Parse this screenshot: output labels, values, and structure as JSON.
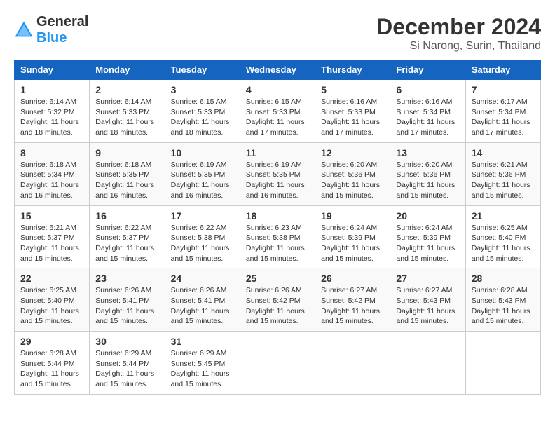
{
  "logo": {
    "text_general": "General",
    "text_blue": "Blue"
  },
  "title": {
    "month_year": "December 2024",
    "location": "Si Narong, Surin, Thailand"
  },
  "weekdays": [
    "Sunday",
    "Monday",
    "Tuesday",
    "Wednesday",
    "Thursday",
    "Friday",
    "Saturday"
  ],
  "weeks": [
    [
      {
        "day": "1",
        "sunrise": "Sunrise: 6:14 AM",
        "sunset": "Sunset: 5:32 PM",
        "daylight": "Daylight: 11 hours and 18 minutes."
      },
      {
        "day": "2",
        "sunrise": "Sunrise: 6:14 AM",
        "sunset": "Sunset: 5:33 PM",
        "daylight": "Daylight: 11 hours and 18 minutes."
      },
      {
        "day": "3",
        "sunrise": "Sunrise: 6:15 AM",
        "sunset": "Sunset: 5:33 PM",
        "daylight": "Daylight: 11 hours and 18 minutes."
      },
      {
        "day": "4",
        "sunrise": "Sunrise: 6:15 AM",
        "sunset": "Sunset: 5:33 PM",
        "daylight": "Daylight: 11 hours and 17 minutes."
      },
      {
        "day": "5",
        "sunrise": "Sunrise: 6:16 AM",
        "sunset": "Sunset: 5:33 PM",
        "daylight": "Daylight: 11 hours and 17 minutes."
      },
      {
        "day": "6",
        "sunrise": "Sunrise: 6:16 AM",
        "sunset": "Sunset: 5:34 PM",
        "daylight": "Daylight: 11 hours and 17 minutes."
      },
      {
        "day": "7",
        "sunrise": "Sunrise: 6:17 AM",
        "sunset": "Sunset: 5:34 PM",
        "daylight": "Daylight: 11 hours and 17 minutes."
      }
    ],
    [
      {
        "day": "8",
        "sunrise": "Sunrise: 6:18 AM",
        "sunset": "Sunset: 5:34 PM",
        "daylight": "Daylight: 11 hours and 16 minutes."
      },
      {
        "day": "9",
        "sunrise": "Sunrise: 6:18 AM",
        "sunset": "Sunset: 5:35 PM",
        "daylight": "Daylight: 11 hours and 16 minutes."
      },
      {
        "day": "10",
        "sunrise": "Sunrise: 6:19 AM",
        "sunset": "Sunset: 5:35 PM",
        "daylight": "Daylight: 11 hours and 16 minutes."
      },
      {
        "day": "11",
        "sunrise": "Sunrise: 6:19 AM",
        "sunset": "Sunset: 5:35 PM",
        "daylight": "Daylight: 11 hours and 16 minutes."
      },
      {
        "day": "12",
        "sunrise": "Sunrise: 6:20 AM",
        "sunset": "Sunset: 5:36 PM",
        "daylight": "Daylight: 11 hours and 15 minutes."
      },
      {
        "day": "13",
        "sunrise": "Sunrise: 6:20 AM",
        "sunset": "Sunset: 5:36 PM",
        "daylight": "Daylight: 11 hours and 15 minutes."
      },
      {
        "day": "14",
        "sunrise": "Sunrise: 6:21 AM",
        "sunset": "Sunset: 5:36 PM",
        "daylight": "Daylight: 11 hours and 15 minutes."
      }
    ],
    [
      {
        "day": "15",
        "sunrise": "Sunrise: 6:21 AM",
        "sunset": "Sunset: 5:37 PM",
        "daylight": "Daylight: 11 hours and 15 minutes."
      },
      {
        "day": "16",
        "sunrise": "Sunrise: 6:22 AM",
        "sunset": "Sunset: 5:37 PM",
        "daylight": "Daylight: 11 hours and 15 minutes."
      },
      {
        "day": "17",
        "sunrise": "Sunrise: 6:22 AM",
        "sunset": "Sunset: 5:38 PM",
        "daylight": "Daylight: 11 hours and 15 minutes."
      },
      {
        "day": "18",
        "sunrise": "Sunrise: 6:23 AM",
        "sunset": "Sunset: 5:38 PM",
        "daylight": "Daylight: 11 hours and 15 minutes."
      },
      {
        "day": "19",
        "sunrise": "Sunrise: 6:24 AM",
        "sunset": "Sunset: 5:39 PM",
        "daylight": "Daylight: 11 hours and 15 minutes."
      },
      {
        "day": "20",
        "sunrise": "Sunrise: 6:24 AM",
        "sunset": "Sunset: 5:39 PM",
        "daylight": "Daylight: 11 hours and 15 minutes."
      },
      {
        "day": "21",
        "sunrise": "Sunrise: 6:25 AM",
        "sunset": "Sunset: 5:40 PM",
        "daylight": "Daylight: 11 hours and 15 minutes."
      }
    ],
    [
      {
        "day": "22",
        "sunrise": "Sunrise: 6:25 AM",
        "sunset": "Sunset: 5:40 PM",
        "daylight": "Daylight: 11 hours and 15 minutes."
      },
      {
        "day": "23",
        "sunrise": "Sunrise: 6:26 AM",
        "sunset": "Sunset: 5:41 PM",
        "daylight": "Daylight: 11 hours and 15 minutes."
      },
      {
        "day": "24",
        "sunrise": "Sunrise: 6:26 AM",
        "sunset": "Sunset: 5:41 PM",
        "daylight": "Daylight: 11 hours and 15 minutes."
      },
      {
        "day": "25",
        "sunrise": "Sunrise: 6:26 AM",
        "sunset": "Sunset: 5:42 PM",
        "daylight": "Daylight: 11 hours and 15 minutes."
      },
      {
        "day": "26",
        "sunrise": "Sunrise: 6:27 AM",
        "sunset": "Sunset: 5:42 PM",
        "daylight": "Daylight: 11 hours and 15 minutes."
      },
      {
        "day": "27",
        "sunrise": "Sunrise: 6:27 AM",
        "sunset": "Sunset: 5:43 PM",
        "daylight": "Daylight: 11 hours and 15 minutes."
      },
      {
        "day": "28",
        "sunrise": "Sunrise: 6:28 AM",
        "sunset": "Sunset: 5:43 PM",
        "daylight": "Daylight: 11 hours and 15 minutes."
      }
    ],
    [
      {
        "day": "29",
        "sunrise": "Sunrise: 6:28 AM",
        "sunset": "Sunset: 5:44 PM",
        "daylight": "Daylight: 11 hours and 15 minutes."
      },
      {
        "day": "30",
        "sunrise": "Sunrise: 6:29 AM",
        "sunset": "Sunset: 5:44 PM",
        "daylight": "Daylight: 11 hours and 15 minutes."
      },
      {
        "day": "31",
        "sunrise": "Sunrise: 6:29 AM",
        "sunset": "Sunset: 5:45 PM",
        "daylight": "Daylight: 11 hours and 15 minutes."
      },
      null,
      null,
      null,
      null
    ]
  ]
}
